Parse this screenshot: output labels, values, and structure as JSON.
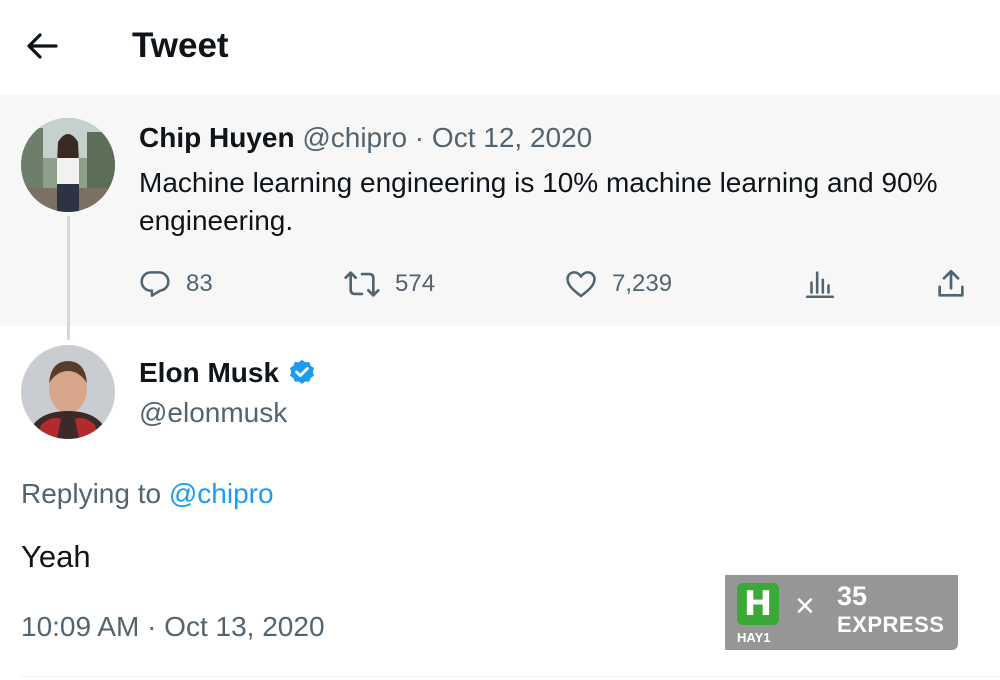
{
  "header": {
    "title": "Tweet"
  },
  "quoted_tweet": {
    "name": "Chip Huyen",
    "handle": "@chipro",
    "separator": " · ",
    "date": "Oct 12, 2020",
    "text": "Machine learning engineering is 10% machine learning and 90% engineering.",
    "stats": {
      "replies": "83",
      "retweets": "574",
      "likes": "7,239"
    }
  },
  "main_tweet": {
    "name": "Elon Musk",
    "handle": "@elonmusk",
    "replying_prefix": "Replying to ",
    "replying_to": "@chipro",
    "text": "Yeah",
    "timestamp": "10:09 AM · Oct 13, 2020"
  },
  "watermark": {
    "logo_letter": "H",
    "small_text": "HAY1",
    "cross": "×",
    "number": "35",
    "text": "EXPRESS"
  },
  "colors": {
    "accent": "#1d9bf0",
    "secondary_text": "#536471",
    "primary_text": "#0f1419",
    "quoted_bg": "#f7f7f7"
  },
  "icons": [
    "back-arrow-icon",
    "reply-icon",
    "retweet-icon",
    "like-icon",
    "views-icon",
    "share-icon",
    "verified-badge-icon"
  ]
}
